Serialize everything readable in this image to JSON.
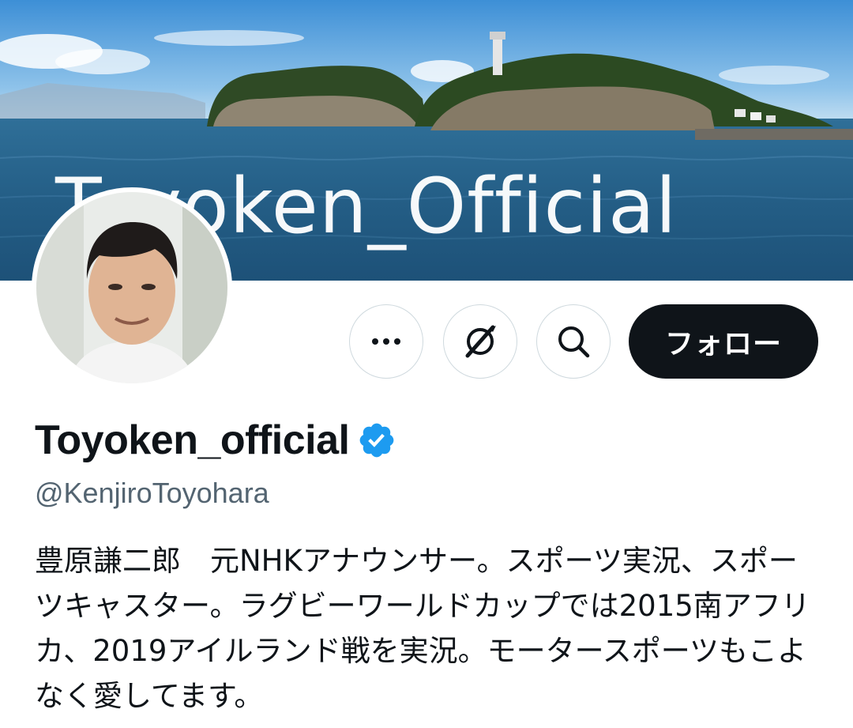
{
  "profile": {
    "banner_text": "Toyoken_Official",
    "display_name": "Toyoken_official",
    "handle": "@KenjiroToyohara",
    "bio": "豊原謙二郎　元NHKアナウンサー。スポーツ実況、スポーツキャスター。ラグビーワールドカップでは2015南アフリカ、2019アイルランド戦を実況。モータースポーツもこよなく愛してます。"
  },
  "actions": {
    "more_icon": "more-icon",
    "grok_icon": "grok-icon",
    "search_icon": "search-icon",
    "follow_label": "フォロー"
  },
  "colors": {
    "verified": "#1d9bf0",
    "follow_bg": "#0f1419",
    "handle": "#536471"
  }
}
